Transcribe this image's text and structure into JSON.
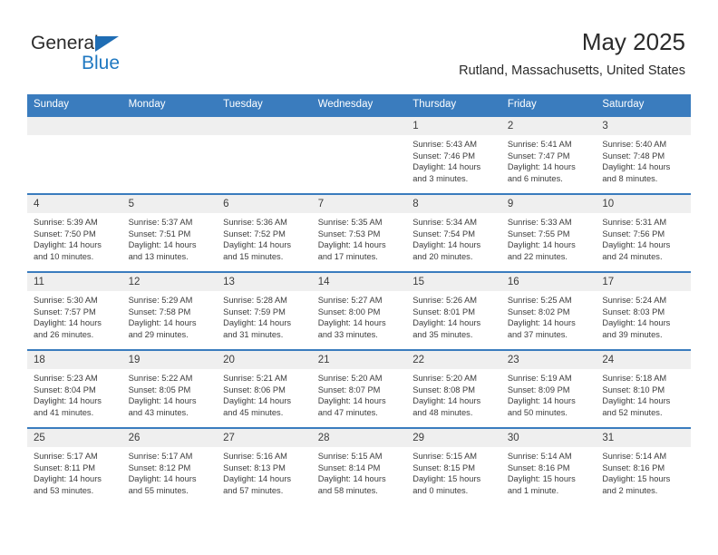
{
  "brand": {
    "name_part1": "General",
    "name_part2": "Blue",
    "triangle_color": "#1f6db4",
    "blue_color": "#1f78c1"
  },
  "header": {
    "title": "May 2025",
    "subtitle": "Rutland, Massachusetts, United States"
  },
  "theme": {
    "header_blue": "#3a7cbe",
    "daynum_strip": "#efefef",
    "text": "#3c3c3c"
  },
  "weekday_headers": [
    "Sunday",
    "Monday",
    "Tuesday",
    "Wednesday",
    "Thursday",
    "Friday",
    "Saturday"
  ],
  "weeks": [
    [
      {
        "day": "",
        "sunrise": "",
        "sunset": "",
        "daylight1": "",
        "daylight2": ""
      },
      {
        "day": "",
        "sunrise": "",
        "sunset": "",
        "daylight1": "",
        "daylight2": ""
      },
      {
        "day": "",
        "sunrise": "",
        "sunset": "",
        "daylight1": "",
        "daylight2": ""
      },
      {
        "day": "",
        "sunrise": "",
        "sunset": "",
        "daylight1": "",
        "daylight2": ""
      },
      {
        "day": "1",
        "sunrise": "Sunrise: 5:43 AM",
        "sunset": "Sunset: 7:46 PM",
        "daylight1": "Daylight: 14 hours",
        "daylight2": "and 3 minutes."
      },
      {
        "day": "2",
        "sunrise": "Sunrise: 5:41 AM",
        "sunset": "Sunset: 7:47 PM",
        "daylight1": "Daylight: 14 hours",
        "daylight2": "and 6 minutes."
      },
      {
        "day": "3",
        "sunrise": "Sunrise: 5:40 AM",
        "sunset": "Sunset: 7:48 PM",
        "daylight1": "Daylight: 14 hours",
        "daylight2": "and 8 minutes."
      }
    ],
    [
      {
        "day": "4",
        "sunrise": "Sunrise: 5:39 AM",
        "sunset": "Sunset: 7:50 PM",
        "daylight1": "Daylight: 14 hours",
        "daylight2": "and 10 minutes."
      },
      {
        "day": "5",
        "sunrise": "Sunrise: 5:37 AM",
        "sunset": "Sunset: 7:51 PM",
        "daylight1": "Daylight: 14 hours",
        "daylight2": "and 13 minutes."
      },
      {
        "day": "6",
        "sunrise": "Sunrise: 5:36 AM",
        "sunset": "Sunset: 7:52 PM",
        "daylight1": "Daylight: 14 hours",
        "daylight2": "and 15 minutes."
      },
      {
        "day": "7",
        "sunrise": "Sunrise: 5:35 AM",
        "sunset": "Sunset: 7:53 PM",
        "daylight1": "Daylight: 14 hours",
        "daylight2": "and 17 minutes."
      },
      {
        "day": "8",
        "sunrise": "Sunrise: 5:34 AM",
        "sunset": "Sunset: 7:54 PM",
        "daylight1": "Daylight: 14 hours",
        "daylight2": "and 20 minutes."
      },
      {
        "day": "9",
        "sunrise": "Sunrise: 5:33 AM",
        "sunset": "Sunset: 7:55 PM",
        "daylight1": "Daylight: 14 hours",
        "daylight2": "and 22 minutes."
      },
      {
        "day": "10",
        "sunrise": "Sunrise: 5:31 AM",
        "sunset": "Sunset: 7:56 PM",
        "daylight1": "Daylight: 14 hours",
        "daylight2": "and 24 minutes."
      }
    ],
    [
      {
        "day": "11",
        "sunrise": "Sunrise: 5:30 AM",
        "sunset": "Sunset: 7:57 PM",
        "daylight1": "Daylight: 14 hours",
        "daylight2": "and 26 minutes."
      },
      {
        "day": "12",
        "sunrise": "Sunrise: 5:29 AM",
        "sunset": "Sunset: 7:58 PM",
        "daylight1": "Daylight: 14 hours",
        "daylight2": "and 29 minutes."
      },
      {
        "day": "13",
        "sunrise": "Sunrise: 5:28 AM",
        "sunset": "Sunset: 7:59 PM",
        "daylight1": "Daylight: 14 hours",
        "daylight2": "and 31 minutes."
      },
      {
        "day": "14",
        "sunrise": "Sunrise: 5:27 AM",
        "sunset": "Sunset: 8:00 PM",
        "daylight1": "Daylight: 14 hours",
        "daylight2": "and 33 minutes."
      },
      {
        "day": "15",
        "sunrise": "Sunrise: 5:26 AM",
        "sunset": "Sunset: 8:01 PM",
        "daylight1": "Daylight: 14 hours",
        "daylight2": "and 35 minutes."
      },
      {
        "day": "16",
        "sunrise": "Sunrise: 5:25 AM",
        "sunset": "Sunset: 8:02 PM",
        "daylight1": "Daylight: 14 hours",
        "daylight2": "and 37 minutes."
      },
      {
        "day": "17",
        "sunrise": "Sunrise: 5:24 AM",
        "sunset": "Sunset: 8:03 PM",
        "daylight1": "Daylight: 14 hours",
        "daylight2": "and 39 minutes."
      }
    ],
    [
      {
        "day": "18",
        "sunrise": "Sunrise: 5:23 AM",
        "sunset": "Sunset: 8:04 PM",
        "daylight1": "Daylight: 14 hours",
        "daylight2": "and 41 minutes."
      },
      {
        "day": "19",
        "sunrise": "Sunrise: 5:22 AM",
        "sunset": "Sunset: 8:05 PM",
        "daylight1": "Daylight: 14 hours",
        "daylight2": "and 43 minutes."
      },
      {
        "day": "20",
        "sunrise": "Sunrise: 5:21 AM",
        "sunset": "Sunset: 8:06 PM",
        "daylight1": "Daylight: 14 hours",
        "daylight2": "and 45 minutes."
      },
      {
        "day": "21",
        "sunrise": "Sunrise: 5:20 AM",
        "sunset": "Sunset: 8:07 PM",
        "daylight1": "Daylight: 14 hours",
        "daylight2": "and 47 minutes."
      },
      {
        "day": "22",
        "sunrise": "Sunrise: 5:20 AM",
        "sunset": "Sunset: 8:08 PM",
        "daylight1": "Daylight: 14 hours",
        "daylight2": "and 48 minutes."
      },
      {
        "day": "23",
        "sunrise": "Sunrise: 5:19 AM",
        "sunset": "Sunset: 8:09 PM",
        "daylight1": "Daylight: 14 hours",
        "daylight2": "and 50 minutes."
      },
      {
        "day": "24",
        "sunrise": "Sunrise: 5:18 AM",
        "sunset": "Sunset: 8:10 PM",
        "daylight1": "Daylight: 14 hours",
        "daylight2": "and 52 minutes."
      }
    ],
    [
      {
        "day": "25",
        "sunrise": "Sunrise: 5:17 AM",
        "sunset": "Sunset: 8:11 PM",
        "daylight1": "Daylight: 14 hours",
        "daylight2": "and 53 minutes."
      },
      {
        "day": "26",
        "sunrise": "Sunrise: 5:17 AM",
        "sunset": "Sunset: 8:12 PM",
        "daylight1": "Daylight: 14 hours",
        "daylight2": "and 55 minutes."
      },
      {
        "day": "27",
        "sunrise": "Sunrise: 5:16 AM",
        "sunset": "Sunset: 8:13 PM",
        "daylight1": "Daylight: 14 hours",
        "daylight2": "and 57 minutes."
      },
      {
        "day": "28",
        "sunrise": "Sunrise: 5:15 AM",
        "sunset": "Sunset: 8:14 PM",
        "daylight1": "Daylight: 14 hours",
        "daylight2": "and 58 minutes."
      },
      {
        "day": "29",
        "sunrise": "Sunrise: 5:15 AM",
        "sunset": "Sunset: 8:15 PM",
        "daylight1": "Daylight: 15 hours",
        "daylight2": "and 0 minutes."
      },
      {
        "day": "30",
        "sunrise": "Sunrise: 5:14 AM",
        "sunset": "Sunset: 8:16 PM",
        "daylight1": "Daylight: 15 hours",
        "daylight2": "and 1 minute."
      },
      {
        "day": "31",
        "sunrise": "Sunrise: 5:14 AM",
        "sunset": "Sunset: 8:16 PM",
        "daylight1": "Daylight: 15 hours",
        "daylight2": "and 2 minutes."
      }
    ]
  ]
}
